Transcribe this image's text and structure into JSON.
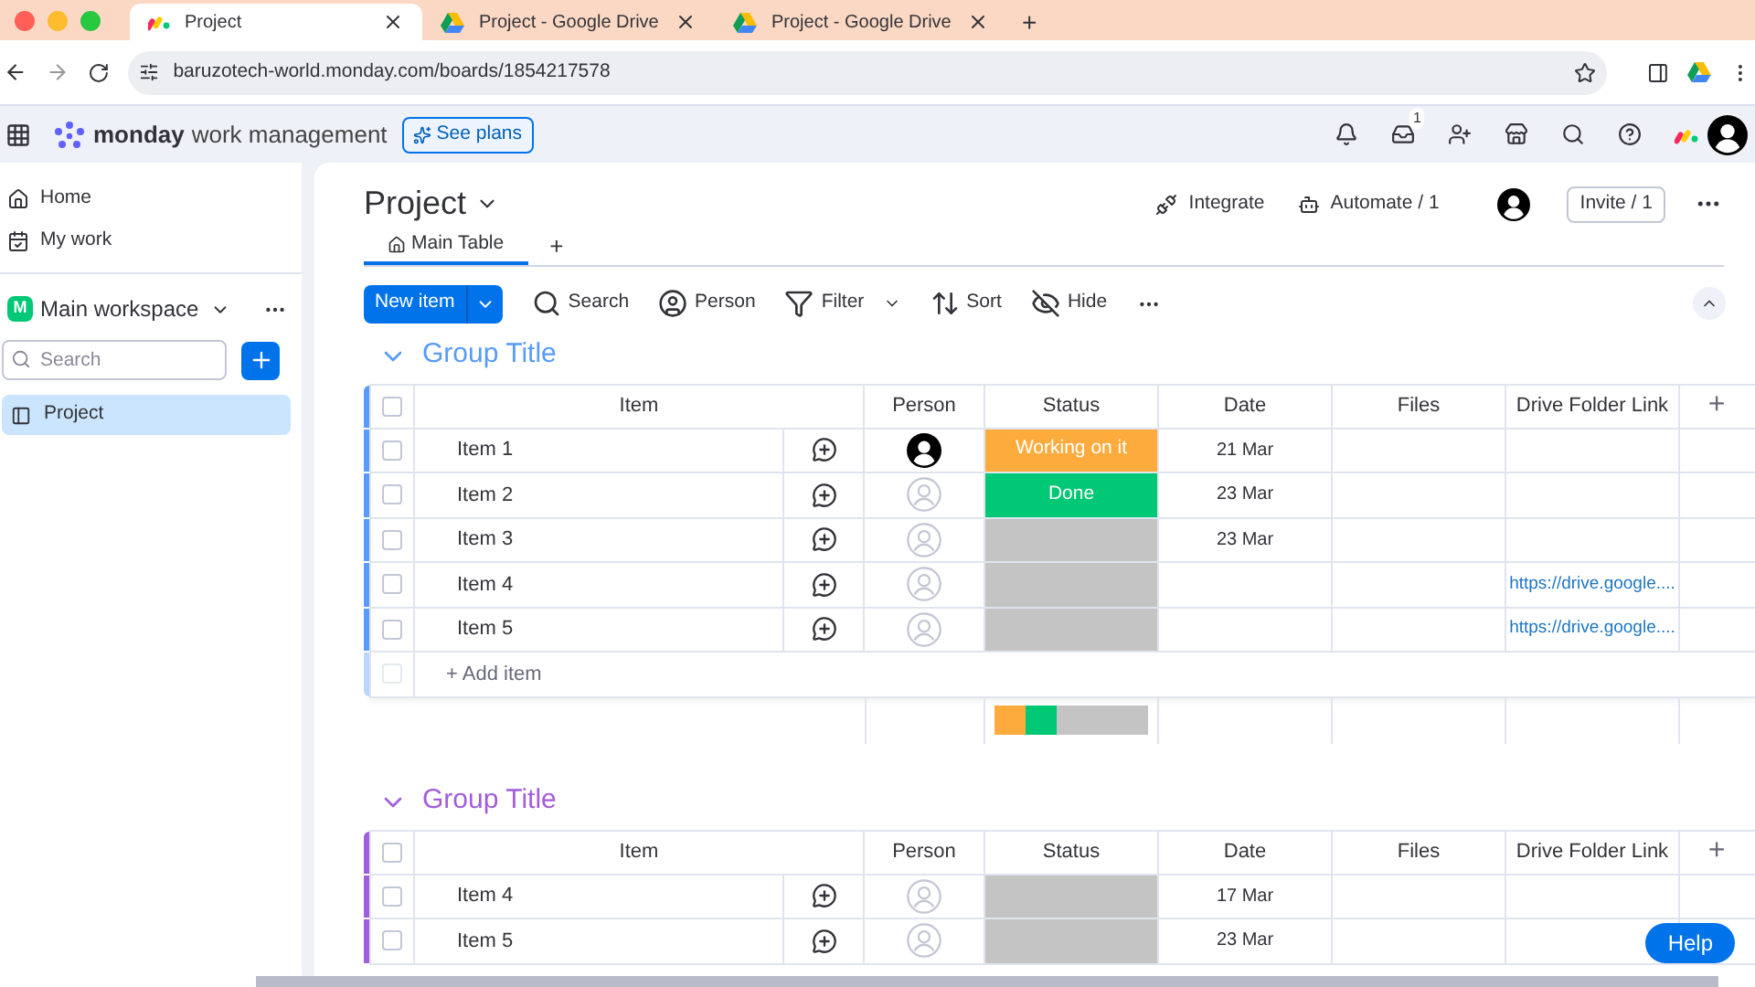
{
  "browser": {
    "tabs": [
      {
        "title": "Project",
        "selected": true
      },
      {
        "title": "Project - Google Drive",
        "selected": false
      },
      {
        "title": "Project - Google Drive",
        "selected": false
      }
    ],
    "new_tab": "+",
    "url": "baruzotech-world.monday.com/boards/1854217578"
  },
  "header": {
    "brand": "monday",
    "product": "work management",
    "see_plans": "See plans",
    "inbox_badge": "1"
  },
  "sidebar": {
    "nav": [
      {
        "label": "Home"
      },
      {
        "label": "My work"
      }
    ],
    "workspace": {
      "initial": "M",
      "name": "Main workspace"
    },
    "search": {
      "placeholder": "Search"
    },
    "boards": [
      {
        "label": "Project",
        "selected": true
      }
    ]
  },
  "board": {
    "title": "Project",
    "integrate": "Integrate",
    "automate": "Automate / 1",
    "invite": "Invite / 1",
    "views": [
      {
        "label": "Main Table",
        "selected": true
      }
    ],
    "add_view": "+",
    "new_item": "New item",
    "tools": [
      {
        "label": "Search",
        "kind": "search"
      },
      {
        "label": "Person",
        "kind": "person"
      },
      {
        "label": "Filter",
        "kind": "filter"
      },
      {
        "label": "Sort",
        "kind": "sort"
      },
      {
        "label": "Hide",
        "kind": "hide"
      }
    ]
  },
  "groups": [
    {
      "title": "Group Title",
      "color": "#579bfc",
      "all_checked": false,
      "columns": [
        "Item",
        "Person",
        "Status",
        "Date",
        "Files",
        "Drive Folder Link"
      ],
      "add_column": "+",
      "rows": [
        {
          "name": "Item 1",
          "checked": false,
          "assigned": true,
          "status": {
            "label": "Working on it",
            "color": "#fdab3d"
          },
          "date": "21 Mar"
        },
        {
          "name": "Item 2",
          "checked": false,
          "assigned": false,
          "status": {
            "label": "Done",
            "color": "#00c875"
          },
          "date": "23 Mar"
        },
        {
          "name": "Item 3",
          "checked": false,
          "assigned": false,
          "status": {
            "color": "#c4c4c4"
          },
          "date": "23 Mar"
        },
        {
          "name": "Item 4",
          "checked": false,
          "assigned": false,
          "status": {
            "color": "#c4c4c4"
          },
          "link": "https://drive.google...."
        },
        {
          "name": "Item 5",
          "checked": false,
          "assigned": false,
          "status": {
            "color": "#c4c4c4"
          },
          "link": "https://drive.google...."
        }
      ],
      "add_item": "+ Add item"
    },
    {
      "title": "Group Title",
      "color": "#a25ddc",
      "all_checked": false,
      "columns": [
        "Item",
        "Person",
        "Status",
        "Date",
        "Files",
        "Drive Folder Link"
      ],
      "add_column": "+",
      "rows": [
        {
          "name": "Item 4",
          "checked": false,
          "assigned": false,
          "status": {
            "color": "#c4c4c4"
          },
          "date": "17 Mar"
        },
        {
          "name": "Item 5",
          "checked": false,
          "assigned": false,
          "status": {
            "color": "#c4c4c4"
          },
          "date": "23 Mar"
        }
      ]
    }
  ],
  "help": "Help"
}
